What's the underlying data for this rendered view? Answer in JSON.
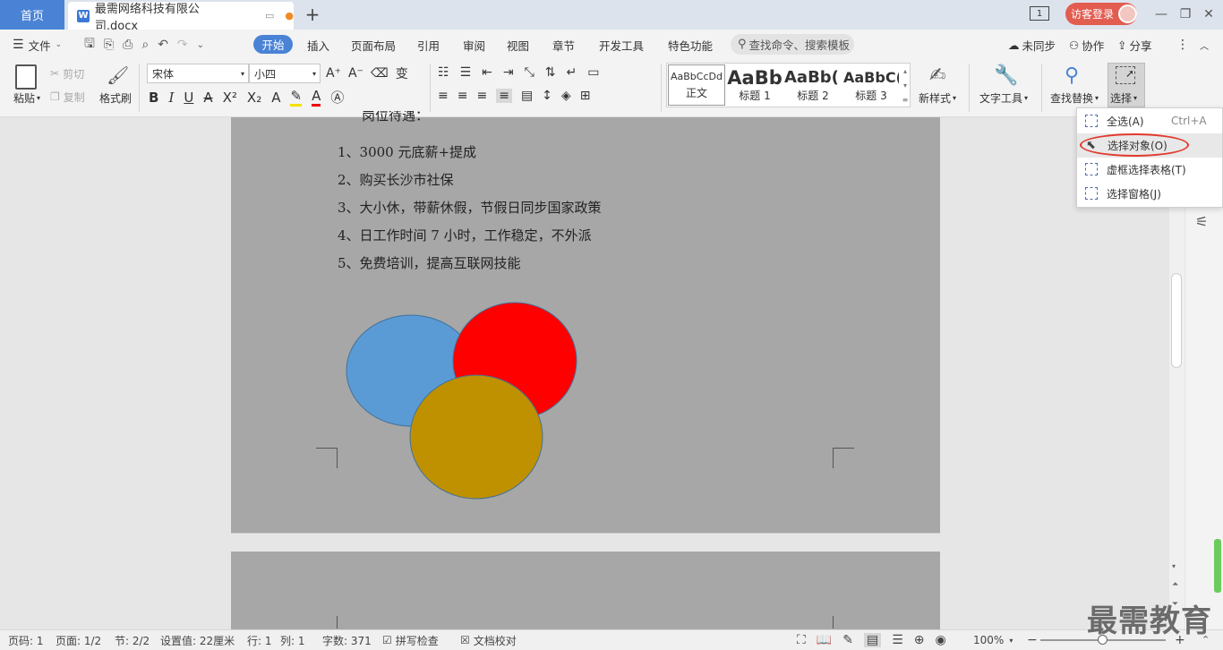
{
  "tabs": {
    "home": "首页",
    "document": "最需网络科技有限公司.docx",
    "new_tab": "+"
  },
  "titlebar": {
    "page_count_badge": "1",
    "visitor_login": "访客登录"
  },
  "menu": {
    "file": "文件",
    "items": [
      "开始",
      "插入",
      "页面布局",
      "引用",
      "审阅",
      "视图",
      "章节",
      "开发工具",
      "特色功能"
    ],
    "search_placeholder": "查找命令、搜索模板",
    "sync": "未同步",
    "collab": "协作",
    "share": "分享"
  },
  "toolbar": {
    "paste": "粘贴",
    "cut": "剪切",
    "copy": "复制",
    "format_painter": "格式刷",
    "font_name": "宋体",
    "font_size": "小四",
    "styles": [
      {
        "preview": "AaBbCcDd",
        "name": "正文"
      },
      {
        "preview": "AaBb",
        "name": "标题 1"
      },
      {
        "preview": "AaBb(",
        "name": "标题 2"
      },
      {
        "preview": "AaBbC(",
        "name": "标题 3"
      }
    ],
    "new_style": "新样式",
    "text_tools": "文字工具",
    "find_replace": "查找替换",
    "select": "选择"
  },
  "select_menu": {
    "items": [
      {
        "label": "全选(A)",
        "shortcut": "Ctrl+A"
      },
      {
        "label": "选择对象(O)",
        "shortcut": ""
      },
      {
        "label": "虚框选择表格(T)",
        "shortcut": ""
      },
      {
        "label": "选择窗格(J)",
        "shortcut": ""
      }
    ]
  },
  "document": {
    "heading": "岗位待遇：",
    "lines": [
      "1、3000 元底薪+提成",
      "2、购买长沙市社保",
      "3、大小休，带薪休假，节假日同步国家政策",
      "4、日工作时间 7 小时，工作稳定，不外派",
      "5、免费培训，提高互联网技能"
    ],
    "shape_colors": {
      "blue": "#5b9bd5",
      "red": "#ff0000",
      "gold": "#bf9000"
    }
  },
  "statusbar": {
    "page": "页码: 1",
    "pages": "页面: 1/2",
    "section": "节: 2/2",
    "setting": "设置值: 22厘米",
    "row": "行: 1",
    "col": "列: 1",
    "word_count": "字数: 371",
    "spell_check": "拼写检查",
    "doc_proof": "文档校对",
    "zoom": "100%"
  },
  "watermark": "最需教育",
  "colors": {
    "accent": "#4a83d6",
    "login": "#e25c50",
    "highlight_oval": "#e23a2e"
  }
}
